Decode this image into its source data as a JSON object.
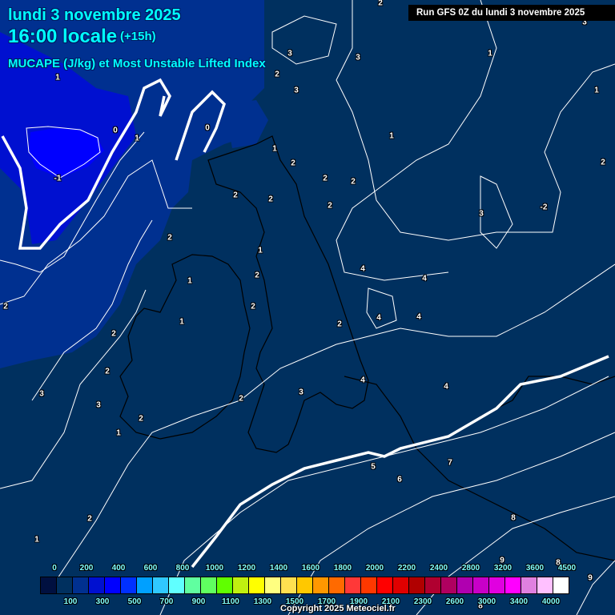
{
  "header": {
    "date": "lundi 3 novembre 2025",
    "time": "16:00 locale",
    "offset": "(+15h)",
    "parameter": "MUCAPE (J/kg) et Most Unstable Lifted Index",
    "run": "Run GFS 0Z du lundi 3 novembre 2025"
  },
  "legend": {
    "top_labels": [
      "0",
      "200",
      "400",
      "600",
      "800",
      "1000",
      "1200",
      "1400",
      "1600",
      "1800",
      "2000",
      "2200",
      "2400",
      "2800",
      "3200",
      "3600",
      "4500"
    ],
    "bottom_labels": [
      "100",
      "300",
      "500",
      "700",
      "900",
      "1100",
      "1300",
      "1500",
      "1700",
      "1900",
      "2100",
      "2300",
      "2600",
      "3000",
      "3400",
      "4000"
    ],
    "colors": [
      "#001040",
      "#00305f",
      "#003090",
      "#0010d0",
      "#0000ff",
      "#0030ff",
      "#00a0ff",
      "#30c8ff",
      "#60ffff",
      "#60ffa0",
      "#60ff60",
      "#60ff00",
      "#c0f010",
      "#ffff00",
      "#ffff80",
      "#ffe050",
      "#ffc800",
      "#ff9800",
      "#ff6a00",
      "#ff3838",
      "#ff3800",
      "#ff0000",
      "#e00000",
      "#b00000",
      "#b00030",
      "#b00060",
      "#b000b0",
      "#c800c8",
      "#e000e0",
      "#ff00ff",
      "#e080e0",
      "#ffc0ff",
      "#ffffff"
    ]
  },
  "contour_labels": [
    "2",
    "3",
    "3",
    "3",
    "1",
    "2",
    "3",
    "1",
    "1",
    "0",
    "1",
    "0",
    "1",
    "1",
    "2",
    "2",
    "2",
    "2",
    "-1",
    "2",
    "2",
    "2",
    "3",
    "-2",
    "2",
    "1",
    "4",
    "2",
    "4",
    "1",
    "2",
    "2",
    "4",
    "4",
    "1",
    "2",
    "2",
    "2",
    "4",
    "4",
    "3",
    "3",
    "2",
    "3",
    "2",
    "1",
    "5",
    "7",
    "6",
    "8",
    "2",
    "1",
    "9",
    "8",
    "9",
    "8"
  ],
  "copyright": "Copyright 2025 Meteociel.fr"
}
